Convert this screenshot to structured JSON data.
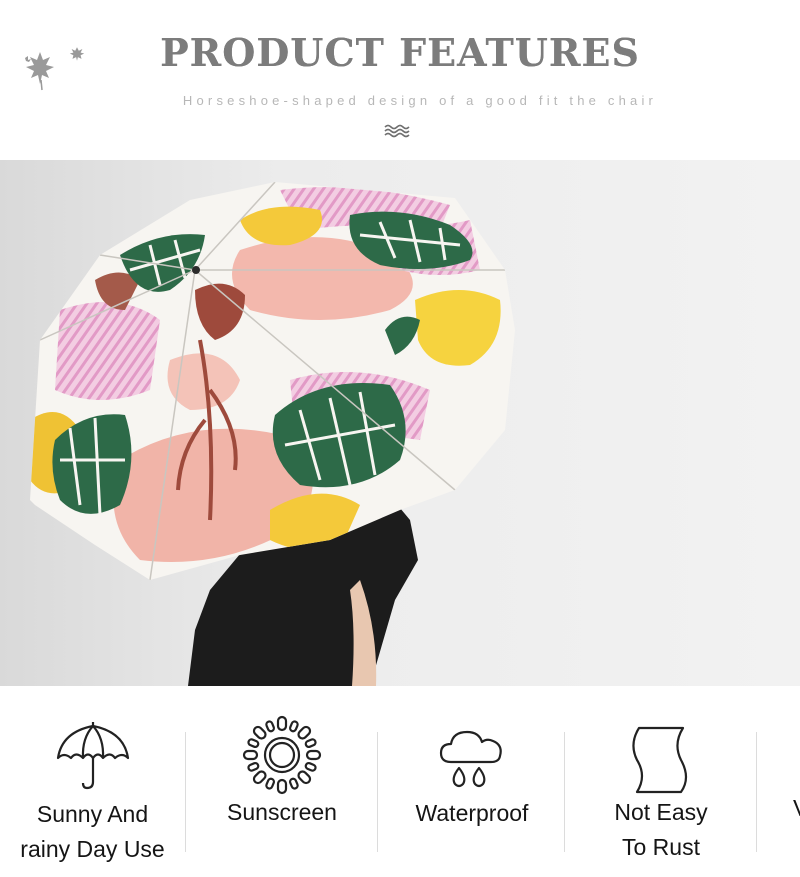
{
  "header": {
    "title": "PRODUCT FEATURES",
    "subtitle": "Horseshoe-shaped design of a good fit the chair",
    "decor_icon": "maple-leaves-icon",
    "wave_icon": "wave-lines-icon"
  },
  "photo": {
    "subject_icon": "umbrella-photo"
  },
  "features": [
    {
      "icon": "umbrella-icon",
      "line1": "Sunny And",
      "line2": "rainy Day Use"
    },
    {
      "icon": "sun-icon",
      "line1": "Sunscreen",
      "line2": ""
    },
    {
      "icon": "rain-cloud-icon",
      "line1": "Waterproof",
      "line2": ""
    },
    {
      "icon": "wave-shape-icon",
      "line1": "Not Easy",
      "line2": "To Rust"
    }
  ],
  "cutoff_text": "V",
  "colors": {
    "title": "#7c7c7c",
    "subtitle": "#b7b7b7",
    "text": "#151515",
    "wall": "#e9e9e9",
    "leaf_green": "#2d6a48",
    "pink": "#f1b8ad",
    "yellow": "#f4c93a",
    "rust": "#9e4a3c",
    "stripe_pink": "#e8a9cf"
  }
}
